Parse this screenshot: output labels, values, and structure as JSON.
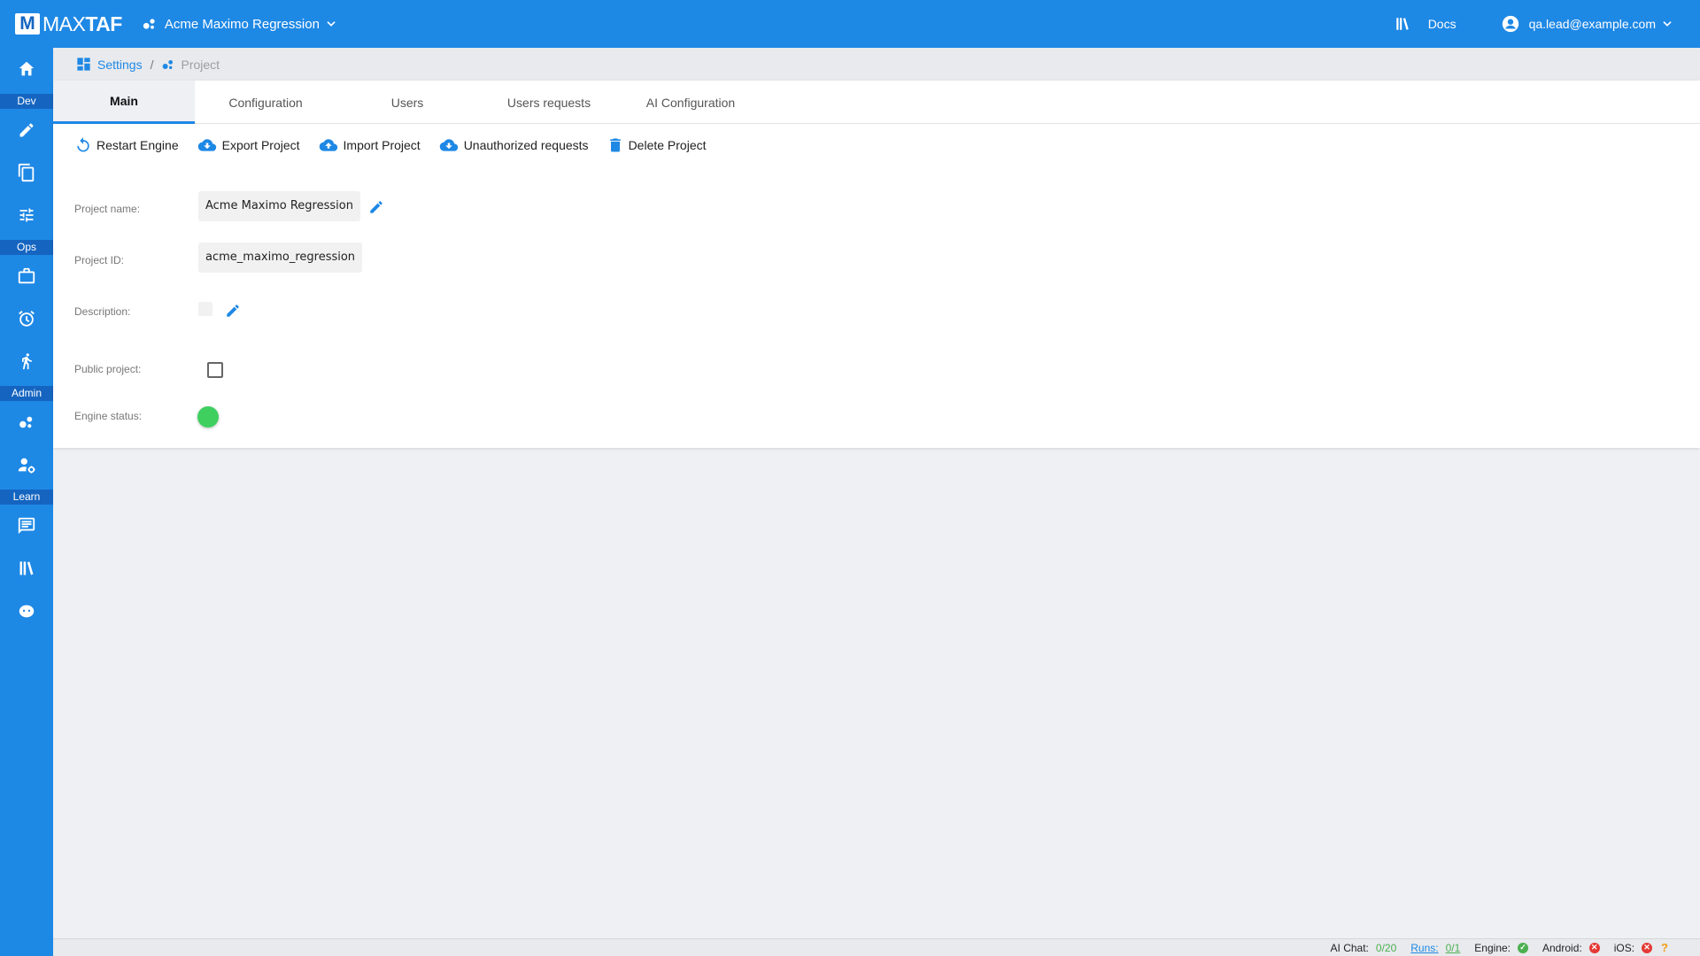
{
  "app": {
    "logo_letter": "M",
    "logo_max": "MAX",
    "logo_taf": "TAF",
    "project_name": "Acme Maximo Regression",
    "docs_label": "Docs",
    "user_email": "qa.lead@example.com",
    "accent_color": "#1e88e5",
    "section_color": "#1565c0"
  },
  "sidebar": {
    "sections": {
      "dev": "Dev",
      "ops": "Ops",
      "admin": "Admin",
      "learn": "Learn"
    },
    "items": [
      {
        "name": "home",
        "icon": "home-icon"
      },
      {
        "name": "edit",
        "icon": "pencil-icon"
      },
      {
        "name": "documents",
        "icon": "copy-icon"
      },
      {
        "name": "tune",
        "icon": "sliders-icon"
      },
      {
        "name": "jobs",
        "icon": "briefcase-icon"
      },
      {
        "name": "schedules",
        "icon": "alarm-icon"
      },
      {
        "name": "runs",
        "icon": "run-icon"
      },
      {
        "name": "projects",
        "icon": "bubbles-icon"
      },
      {
        "name": "user-settings",
        "icon": "user-gear-icon"
      },
      {
        "name": "feedback",
        "icon": "chat-icon"
      },
      {
        "name": "library",
        "icon": "library-icon"
      },
      {
        "name": "support",
        "icon": "headset-icon"
      }
    ]
  },
  "breadcrumb": {
    "settings": "Settings",
    "separator": "/",
    "project": "Project"
  },
  "tabs": [
    {
      "label": "Main",
      "active": true
    },
    {
      "label": "Configuration",
      "active": false
    },
    {
      "label": "Users",
      "active": false
    },
    {
      "label": "Users requests",
      "active": false
    },
    {
      "label": "AI Configuration",
      "active": false
    }
  ],
  "actions": {
    "restart": "Restart Engine",
    "export": "Export Project",
    "import": "Import Project",
    "unauthorized": "Unauthorized requests",
    "delete": "Delete Project"
  },
  "form": {
    "project_name_label": "Project name:",
    "project_name_value": "Acme Maximo Regression",
    "project_id_label": "Project ID:",
    "project_id_value": "acme_maximo_regression",
    "description_label": "Description:",
    "description_value": "",
    "public_label": "Public project:",
    "public_checked": false,
    "engine_status_label": "Engine status:",
    "engine_status_color": "#3fcf5f"
  },
  "statusbar": {
    "ai_chat_label": "AI Chat:",
    "ai_chat_value": "0/20",
    "runs_label": "Runs:",
    "runs_value": "0/1",
    "engine_label": "Engine:",
    "android_label": "Android:",
    "ios_label": "iOS:",
    "help_glyph": "?"
  }
}
